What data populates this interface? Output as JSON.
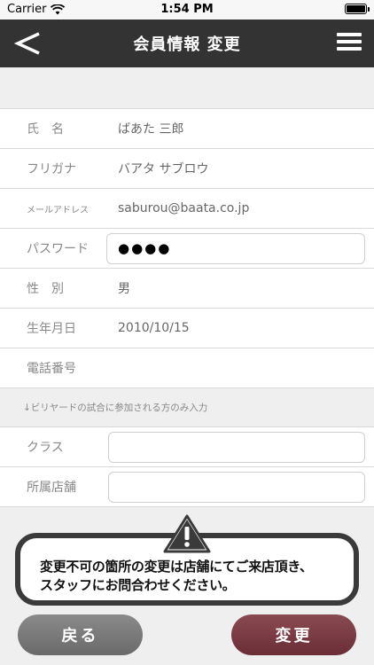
{
  "status_bar": {
    "carrier": "Carrier",
    "time": "1:54 PM"
  },
  "nav": {
    "title": "会員情報 変更"
  },
  "profile": {
    "name_label": "氏　名",
    "name_value": "ばあた 三郎",
    "kana_label": "フリガナ",
    "kana_value": "バアタ サブロウ",
    "email_label": "メールアドレス",
    "email_value": "saburou@baata.co.jp",
    "password_label": "パスワード",
    "password_value": "●●●●",
    "gender_label": "性　別",
    "gender_value": "男",
    "birthday_label": "生年月日",
    "birthday_value": "2010/10/15",
    "phone_label": "電話番号",
    "phone_value": ""
  },
  "billiards_note": "↓ビリヤードの試合に参加される方のみ入力",
  "billiards": {
    "class_label": "クラス",
    "class_value": "",
    "store_label": "所属店舗",
    "store_value": ""
  },
  "warning": {
    "line1": "変更不可の箇所の変更は店舗にてご来店頂き、",
    "line2": "スタッフにお問合わせください。"
  },
  "buttons": {
    "back_label": "戻る",
    "change_label": "変更"
  },
  "colors": {
    "nav_bg": "#333333",
    "change_button": "#7a3a42",
    "back_button": "#7a7a7a"
  }
}
